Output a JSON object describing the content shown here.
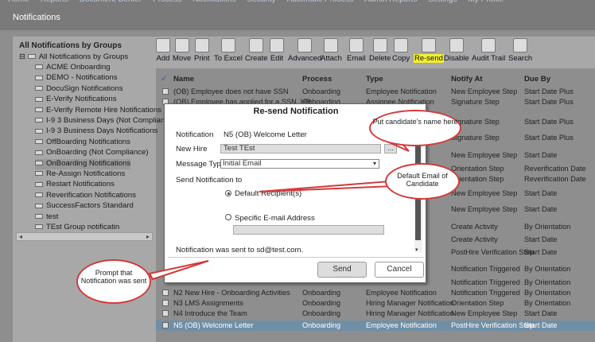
{
  "nav": [
    "Home",
    "Reports",
    "Document Center",
    "Process",
    "Notifications",
    "Security",
    "Automatic Process",
    "Admin Reports",
    "Settings",
    "My Profile"
  ],
  "app_title": "Notifications",
  "tree": {
    "header": "All Notifications by Groups",
    "root": "All Notifications by Groups",
    "items": [
      "ACME Onboarding",
      "DEMO - Notifications",
      "DocuSign Notifications",
      "E-Verify Notifications",
      "E-Verify Remote Hire Notifications",
      "I-9 3 Business Days (Not Complianc",
      "I-9 3 Business Days Notifications",
      "OffBoarding Notifications",
      "OnBoarding (Not Compliance)",
      "OnBoarding Notifications",
      "Re-Assign Notifications",
      "Restart Notifications",
      "Reverification Notifications",
      "SuccessFactors Standard",
      "test",
      "TEst Group notificatin"
    ],
    "selected": "OnBoarding Notifications"
  },
  "toolbar": [
    "Add",
    "Move",
    "Print",
    "To Excel",
    "Create",
    "Edit",
    "Advanced",
    "Attach",
    "Email",
    "Delete",
    "Copy",
    "Re-send",
    "Disable",
    "Audit Trail",
    "Search"
  ],
  "columns": {
    "name": "Name",
    "process": "Process",
    "type": "Type",
    "notify": "Notify At",
    "due": "Due By"
  },
  "rows": [
    {
      "name": "(OB) Employee does not have SSN",
      "process": "Onboarding",
      "type": "Employee Notification",
      "notify": "New Employee Step",
      "due": "Start Date Plus"
    },
    {
      "name": "(OB) Employee has applied for a SSN. HR",
      "process": "Onboarding",
      "type": "Assignee Notification",
      "notify": "Signature Step",
      "due": "Start Date Plus"
    }
  ],
  "right_cells": [
    {
      "notify": "Signature Step",
      "due": "Start Date Plus"
    },
    {
      "notify": "Signature Step",
      "due": "Start Date Plus"
    },
    {
      "notify": "New Employee Step",
      "due": "Start Date"
    },
    {
      "notify": "Orientation Step",
      "due": "Reverification Date"
    },
    {
      "notify": "Orientation Step",
      "due": "Reverification Date"
    },
    {
      "notify": "New Employee Step",
      "due": "Start Date"
    },
    {
      "notify": "New Employee Step",
      "due": "Start Date"
    },
    {
      "notify": "Create Activity",
      "due": "By Orientation"
    },
    {
      "notify": "Create Activity",
      "due": "Start Date"
    },
    {
      "notify": "PostHire Verification Step",
      "due": "Start Date"
    },
    {
      "notify": "Notification Triggered",
      "due": "By Orientation"
    },
    {
      "notify": "Notification Triggered",
      "due": "By Orientation"
    }
  ],
  "bottom_rows": [
    {
      "name": "N2 New Hire - Onboarding Activities",
      "process": "Onboarding",
      "type": "Employee Notification",
      "notify": "Notification Triggered",
      "due": "By Orientation"
    },
    {
      "name": "N3 LMS Assignments",
      "process": "Onboarding",
      "type": "Hiring Manager Notification",
      "notify": "Orientation Step",
      "due": "By Orientation"
    },
    {
      "name": "N4 Introduce the Team",
      "process": "Onboarding",
      "type": "Hiring Manager Notification",
      "notify": "New Employee Step",
      "due": "Start Date"
    },
    {
      "name": "N5 (OB) Welcome Letter",
      "process": "Onboarding",
      "type": "Employee Notification",
      "notify": "PostHire Verification Step",
      "due": "Start Date"
    }
  ],
  "dialog": {
    "title": "Re-send Notification",
    "notification_label": "Notification",
    "notification_value": "N5 (OB) Welcome Letter",
    "newhire_label": "New Hire",
    "newhire_value": "Test TEst",
    "browse": "...",
    "msgtype_label": "Message Type",
    "msgtype_value": "Initial Email",
    "send_to": "Send Notification to",
    "opt_default": "Default Recipient(s)",
    "opt_specific": "Specific E-mail Address",
    "status": "Notification was sent to sd@test.com.",
    "send": "Send",
    "cancel": "Cancel"
  },
  "callouts": {
    "name": "Put candidate's name here",
    "email": "Default Email of Candidate",
    "prompt": "Prompt that Notification was sent"
  },
  "colors": {
    "highlight": "#f3f02a",
    "callout_border": "#d23a3a",
    "selected_row": "#6f8fa6"
  }
}
